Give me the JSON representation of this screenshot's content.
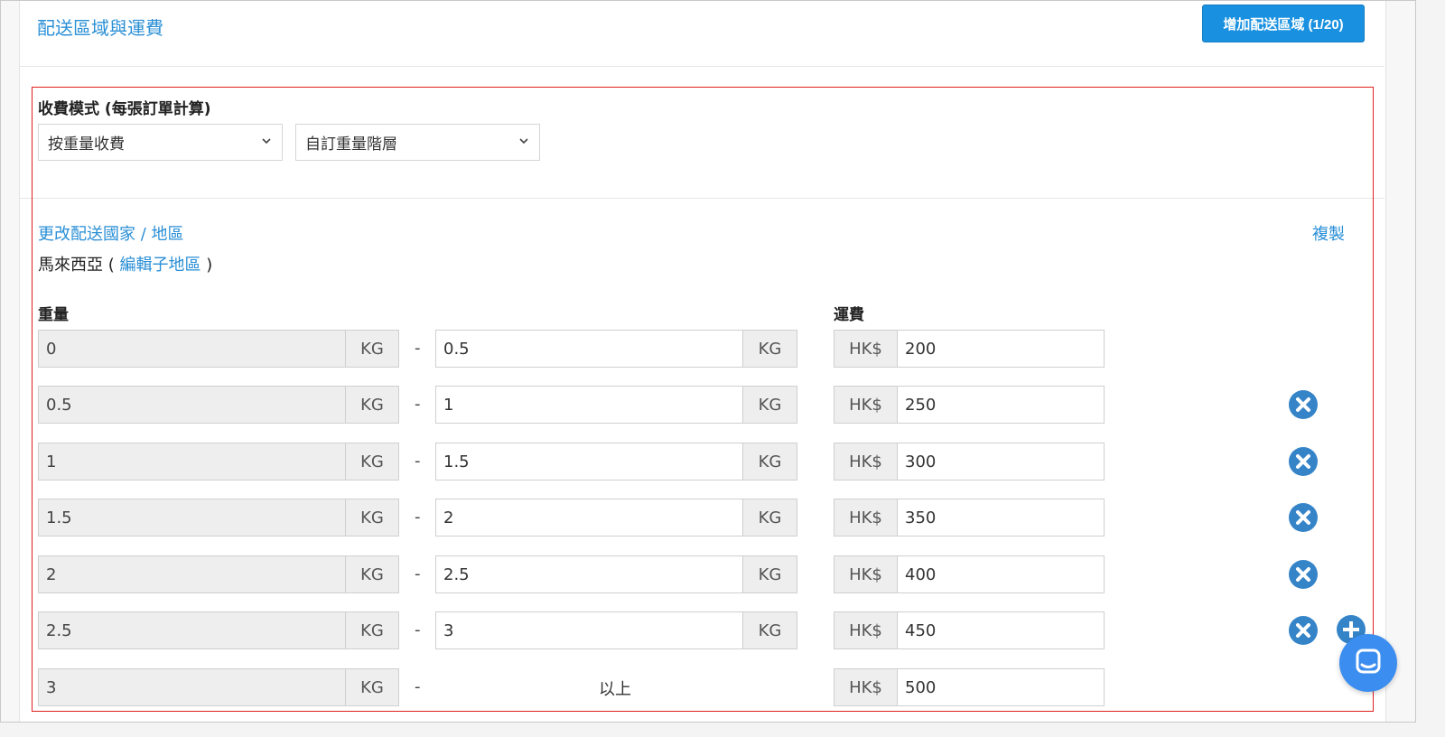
{
  "header": {
    "title": "配送區域與運費",
    "add_zone_label": "增加配送區域 (1/20)"
  },
  "billing": {
    "label": "收費模式 (每張訂單計算)",
    "mode_select": "按重量收費",
    "tier_select": "自訂重量階層"
  },
  "zone": {
    "change_link": "更改配送國家 / 地區",
    "copy_link": "複製",
    "country": "馬來西亞",
    "open_paren": "(",
    "edit_subregion_link": "編輯子地區",
    "close_paren": ")"
  },
  "table": {
    "weight_header": "重量",
    "fee_header": "運費",
    "unit": "KG",
    "currency": "HK$",
    "dash": "-",
    "above_label": "以上",
    "rows": [
      {
        "from": "0",
        "to": "0.5",
        "fee": "200",
        "removable": false
      },
      {
        "from": "0.5",
        "to": "1",
        "fee": "250",
        "removable": true
      },
      {
        "from": "1",
        "to": "1.5",
        "fee": "300",
        "removable": true
      },
      {
        "from": "1.5",
        "to": "2",
        "fee": "350",
        "removable": true
      },
      {
        "from": "2",
        "to": "2.5",
        "fee": "400",
        "removable": true
      },
      {
        "from": "2.5",
        "to": "3",
        "fee": "450",
        "removable": true
      },
      {
        "from": "3",
        "to": "",
        "fee": "500",
        "removable": false
      }
    ]
  },
  "icons": {
    "remove": "close-circle-icon",
    "add": "plus-circle-icon",
    "chat": "chat-bubble-icon",
    "chevron": "chevron-down-icon"
  },
  "colors": {
    "accent": "#2a8fd6",
    "button": "#1a91e0",
    "highlight_border": "#e0201f",
    "remove_icon": "#3584c8"
  }
}
